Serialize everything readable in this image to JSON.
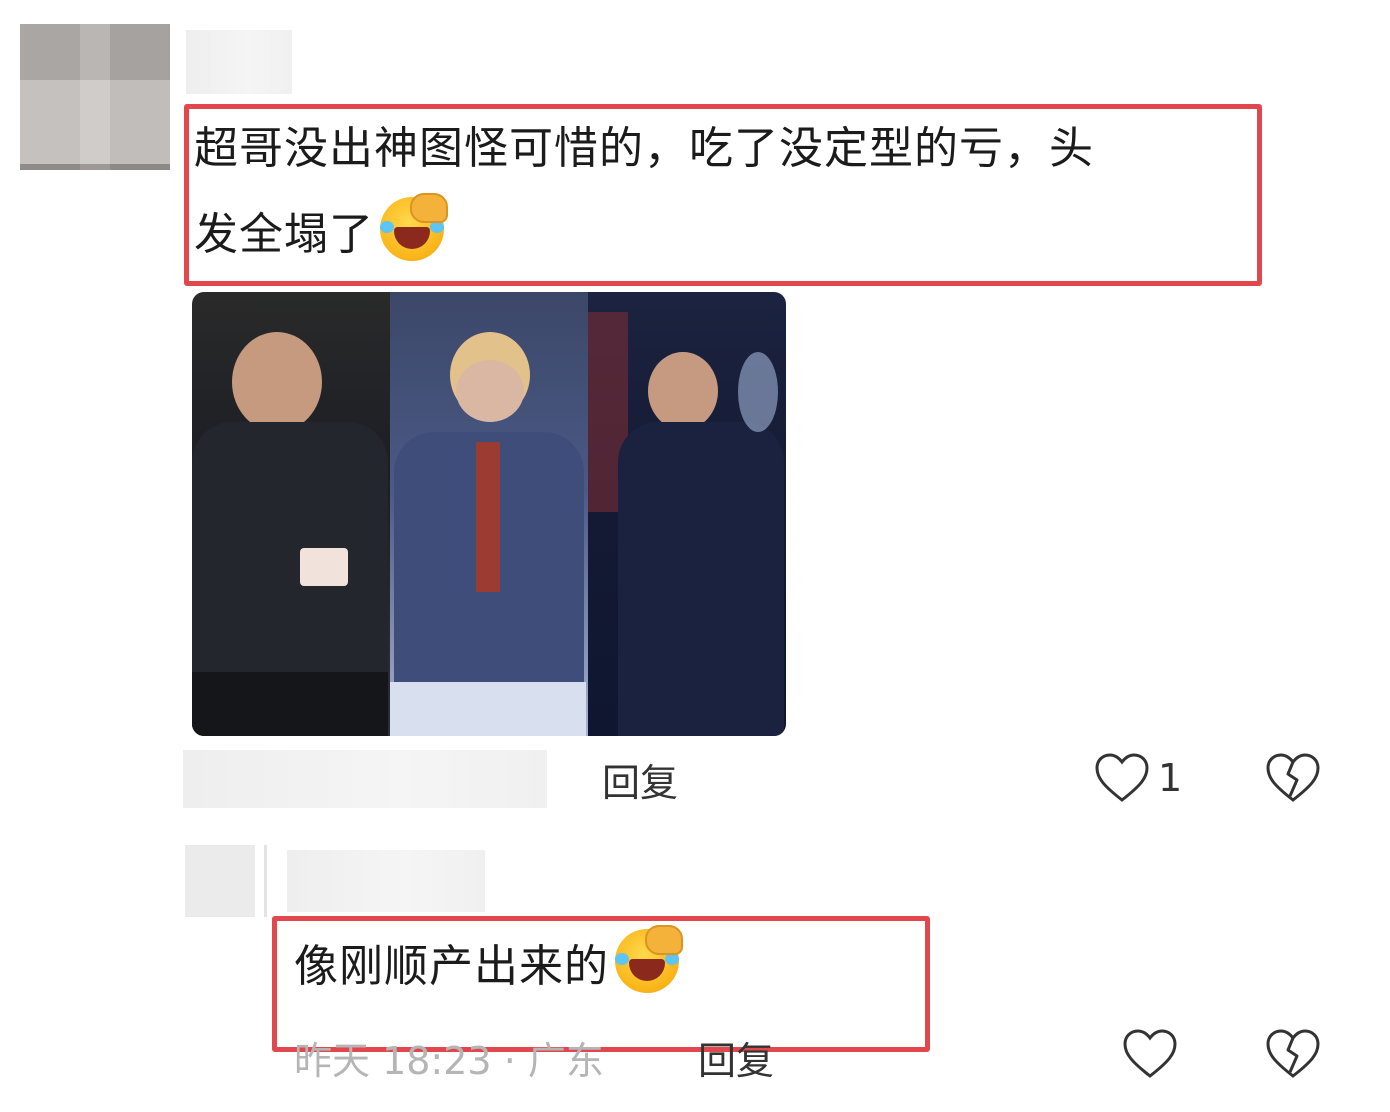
{
  "comment": {
    "text_line1": "超哥没出神图怪可惜的，吃了没定型的亏，头",
    "text_line2": "发全塌了",
    "emoji": "laughing-face-with-hand-emoji",
    "image_alt": "three-panel photo collage",
    "reply_label": "回复",
    "like_count": "1"
  },
  "reply": {
    "text": "像刚顺产出来的",
    "emoji": "laughing-face-with-hand-emoji",
    "timestamp": "昨天 18:23",
    "separator": "·",
    "location": "广东",
    "reply_label": "回复"
  },
  "icons": {
    "like": "heart-outline-icon",
    "dislike": "broken-heart-icon"
  },
  "colors": {
    "highlight": "#e2474d",
    "text": "#1b1b1b",
    "muted": "#b5b5b5"
  }
}
